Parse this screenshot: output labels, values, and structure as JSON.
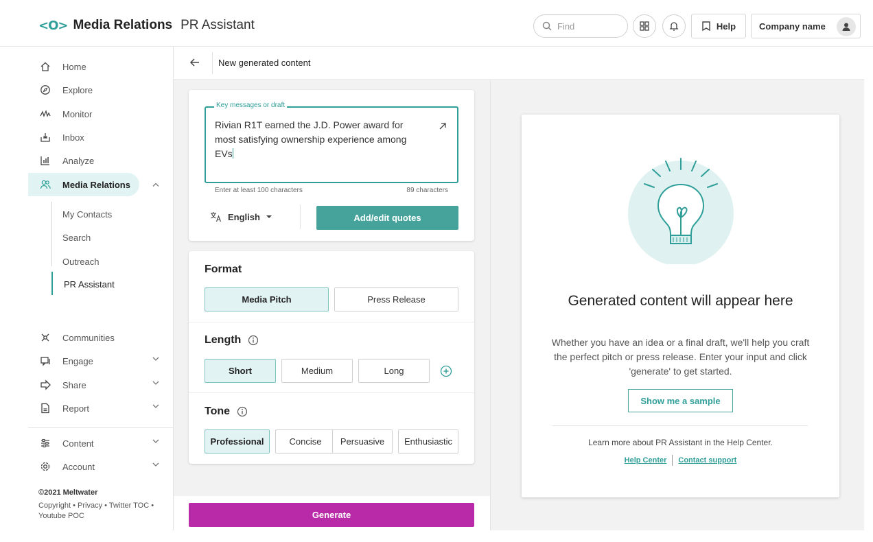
{
  "app": {
    "logo_mark": "<O>",
    "title": "Media Relations",
    "subtitle": "PR Assistant"
  },
  "topbar": {
    "find_placeholder": "Find",
    "help_label": "Help",
    "company_label": "Company name"
  },
  "sidebar": {
    "items": [
      {
        "label": "Home",
        "icon": "home-icon"
      },
      {
        "label": "Explore",
        "icon": "compass-icon"
      },
      {
        "label": "Monitor",
        "icon": "monitor-icon"
      },
      {
        "label": "Inbox",
        "icon": "inbox-icon"
      },
      {
        "label": "Analyze",
        "icon": "analyze-icon"
      },
      {
        "label": "Media Relations",
        "icon": "people-icon",
        "active": true
      }
    ],
    "subitems": [
      "My Contacts",
      "Search",
      "Outreach",
      "PR Assistant"
    ],
    "items2": [
      {
        "label": "Communities",
        "icon": "communities-icon"
      },
      {
        "label": "Engage",
        "icon": "engage-icon"
      },
      {
        "label": "Share",
        "icon": "share-icon"
      },
      {
        "label": "Report",
        "icon": "report-icon"
      }
    ],
    "items3": [
      {
        "label": "Content",
        "icon": "sliders-icon"
      },
      {
        "label": "Account",
        "icon": "gear-icon"
      }
    ],
    "footer_bold": "©2021 Meltwater",
    "footer_links": "Copyright • Privacy • Twitter TOC • Youtube POC"
  },
  "page": {
    "title": "New generated content"
  },
  "form": {
    "key_messages_label": "Key messages or draft",
    "key_messages_value": "Rivian R1T earned the J.D. Power award for most satisfying ownership experience among EVs",
    "hint": "Enter at least 100 characters",
    "char_count": "89 characters",
    "language": "English",
    "quotes_button": "Add/edit quotes",
    "format_title": "Format",
    "format_options": [
      "Media Pitch",
      "Press Release"
    ],
    "length_title": "Length",
    "length_options": [
      "Short",
      "Medium",
      "Long"
    ],
    "tone_title": "Tone",
    "tone_options": [
      "Professional",
      "Concise",
      "Persuasive",
      "Enthusiastic"
    ],
    "generate_button": "Generate"
  },
  "result": {
    "title": "Generated content will appear here",
    "description": "Whether you have an idea or a final draft, we'll help you craft the perfect pitch or press release. Enter your input and click 'generate' to get started.",
    "sample_button": "Show me a sample",
    "learn_text": "Learn more about PR Assistant in the Help Center.",
    "help_center_link": "Help Center",
    "contact_link": "Contact support"
  },
  "colors": {
    "accent": "#2f9e98",
    "button_teal": "#46a39c",
    "generate": "#b82aa8",
    "selected_bg": "#e1f4f3"
  }
}
